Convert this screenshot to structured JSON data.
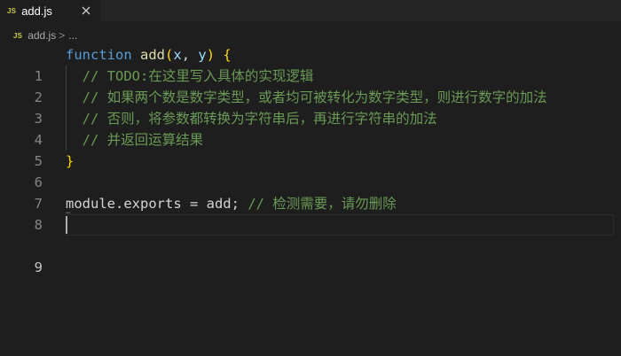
{
  "tab": {
    "icon": "JS",
    "label": "add.js",
    "close": "close-icon"
  },
  "breadcrumb": {
    "icon": "JS",
    "file": "add.js",
    "separator": ">",
    "more": "..."
  },
  "editor": {
    "line_numbers": [
      "1",
      "2",
      "3",
      "4",
      "5",
      "6",
      "7",
      "8",
      "9"
    ],
    "line1": {
      "kw": "function",
      "name": "add",
      "open": "(",
      "p1": "x",
      "comma": ", ",
      "p2": "y",
      "close": ")",
      "brace": "{"
    },
    "line2": "// TODO:在这里写入具体的实现逻辑",
    "line3": "// 如果两个数是数字类型，或者均可被转化为数字类型，则进行数字的加法",
    "line4": "// 否则，将参数都转换为字符串后，再进行字符串的加法",
    "line5": "// 并返回运算结果",
    "line6": "}",
    "line8": {
      "code": "module.exports = add;",
      "comment": "// 检测需要，请勿删除"
    }
  },
  "colors": {
    "background": "#1e1e1e",
    "keyword": "#569cd6",
    "function": "#dcdcaa",
    "parameter": "#9cdcfe",
    "comment": "#6a9955",
    "brace": "#ffd700"
  }
}
